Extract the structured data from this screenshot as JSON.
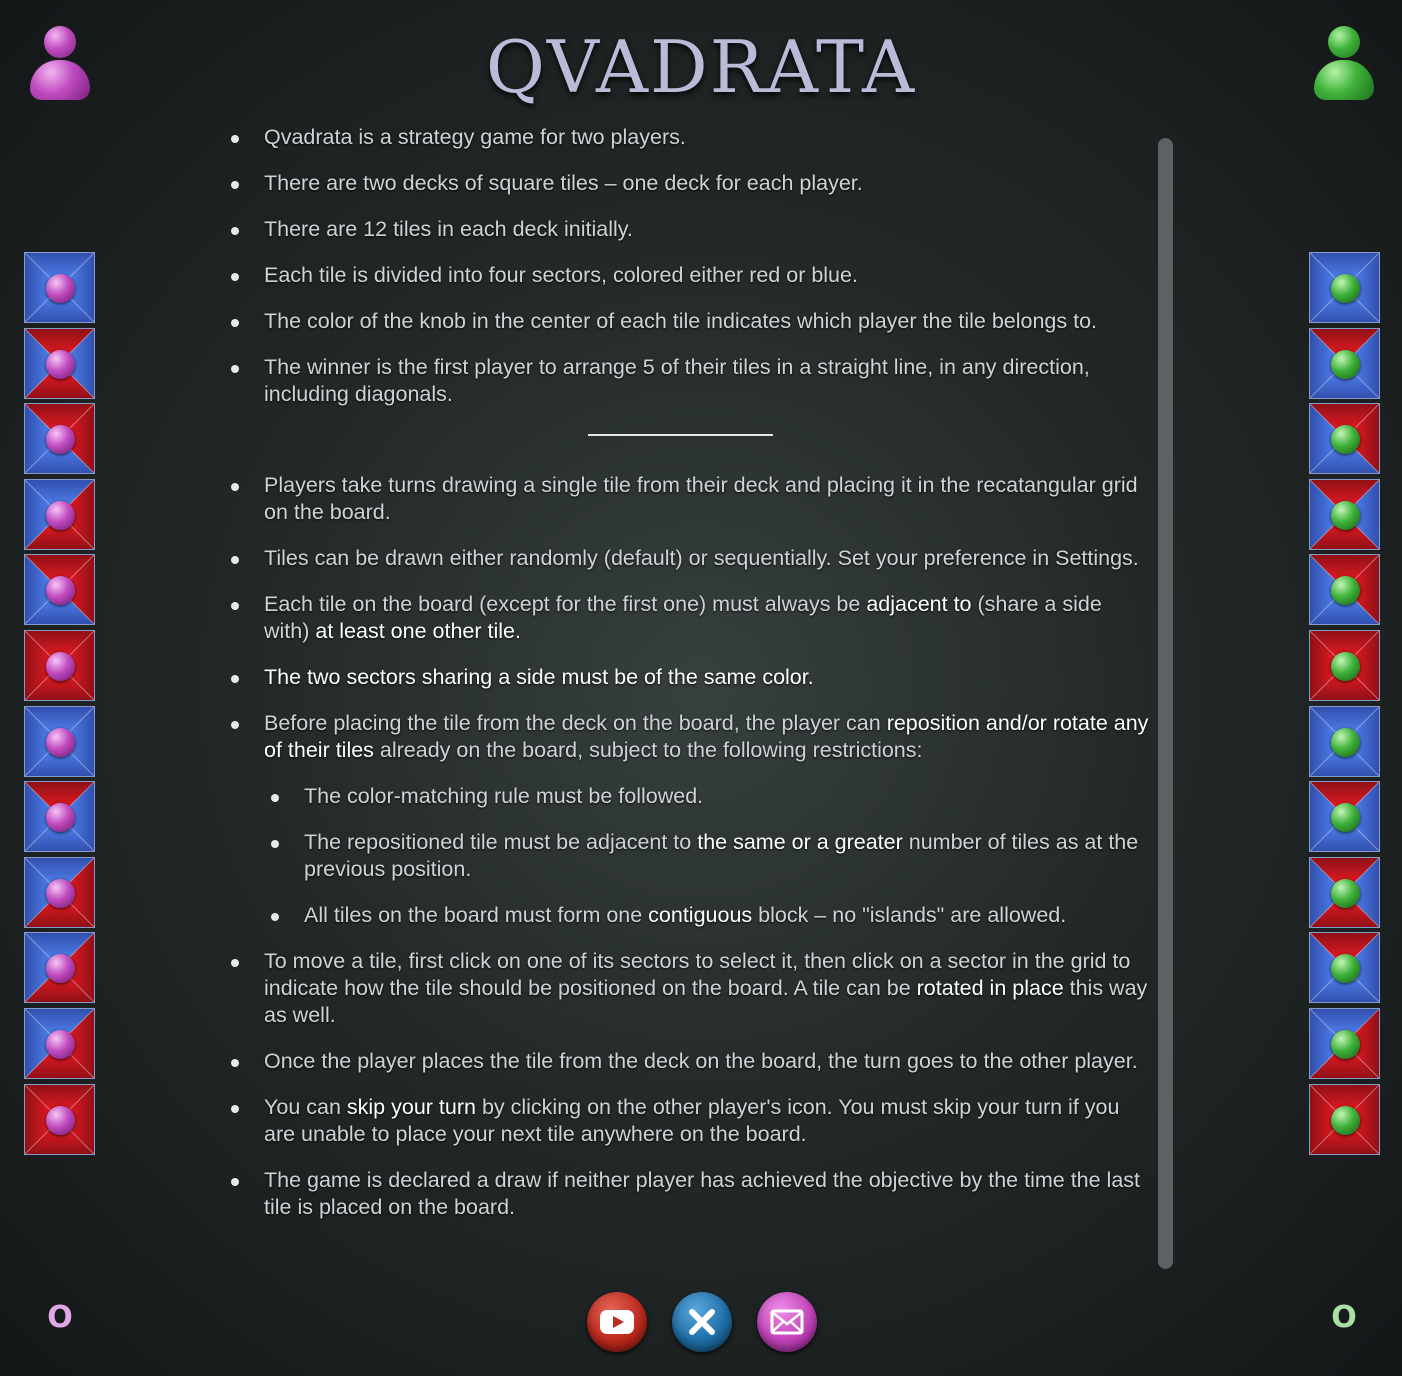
{
  "title": "QVADRATA",
  "players": {
    "left": {
      "icon": "purple-player-icon",
      "score": "O",
      "color": "#c04cc0"
    },
    "right": {
      "icon": "green-player-icon",
      "score": "O",
      "color": "#3fb23a"
    }
  },
  "colors": {
    "red": "#b3141b",
    "blue": "#3d63d9"
  },
  "decks": {
    "left": [
      [
        "blue",
        "blue",
        "blue",
        "blue"
      ],
      [
        "red",
        "blue",
        "red",
        "blue"
      ],
      [
        "red",
        "red",
        "blue",
        "blue"
      ],
      [
        "blue",
        "red",
        "red",
        "blue"
      ],
      [
        "red",
        "red",
        "blue",
        "blue"
      ],
      [
        "red",
        "red",
        "red",
        "red"
      ],
      [
        "blue",
        "blue",
        "blue",
        "blue"
      ],
      [
        "red",
        "blue",
        "blue",
        "blue"
      ],
      [
        "blue",
        "red",
        "red",
        "blue"
      ],
      [
        "blue",
        "red",
        "red",
        "blue"
      ],
      [
        "blue",
        "red",
        "red",
        "blue"
      ],
      [
        "red",
        "red",
        "red",
        "red"
      ]
    ],
    "right": [
      [
        "blue",
        "blue",
        "blue",
        "blue"
      ],
      [
        "red",
        "blue",
        "blue",
        "blue"
      ],
      [
        "red",
        "red",
        "blue",
        "blue"
      ],
      [
        "red",
        "blue",
        "red",
        "blue"
      ],
      [
        "red",
        "red",
        "blue",
        "blue"
      ],
      [
        "red",
        "red",
        "red",
        "red"
      ],
      [
        "blue",
        "blue",
        "blue",
        "blue"
      ],
      [
        "red",
        "blue",
        "blue",
        "blue"
      ],
      [
        "red",
        "blue",
        "red",
        "blue"
      ],
      [
        "red",
        "blue",
        "blue",
        "blue"
      ],
      [
        "blue",
        "red",
        "red",
        "blue"
      ],
      [
        "red",
        "red",
        "red",
        "red"
      ]
    ]
  },
  "rules": {
    "intro": [
      "Qvadrata is a strategy game for two players.",
      "There are two decks of square tiles – one deck for each player.",
      "There are 12 tiles in each deck initially.",
      "Each tile is divided into four sectors, colored either red or blue.",
      "The color of the knob in the center of each tile indicates which player the tile belongs to.",
      "The winner is the first player to arrange 5 of their tiles in a straight line, in any direction, including diagonals."
    ],
    "play_1": "Players take turns drawing a single tile from their deck and placing it in the recatangular grid on the board.",
    "play_2": "Tiles can be drawn either randomly (default) or sequentially. Set your preference in Settings.",
    "play_3": {
      "a": "Each tile on the board (except for the first one) must always be ",
      "b": "adjacent to",
      "c": " (share a side with) ",
      "d": "at least one other tile."
    },
    "play_4": "The two sectors sharing a side must be of the same color.",
    "play_5": {
      "a": "Before placing the tile from the deck on the board, the player can ",
      "b": "reposition and/or rotate any of their tiles",
      "c": " already on the board, subject to the following restrictions:"
    },
    "sub_1": "The color-matching rule must be followed.",
    "sub_2": {
      "a": "The repositioned tile must be adjacent to ",
      "b": "the same or a greater",
      "c": " number of tiles as at the previous position."
    },
    "sub_3": {
      "a": "All tiles on the board must form one ",
      "b": "contiguous",
      "c": " block – no \"islands\" are allowed."
    },
    "play_6": {
      "a": "To move a tile, first click on one of its sectors to select it, then click on a sector in the grid to indicate how the tile should be positioned on the board. A tile can be ",
      "b": "rotated in place",
      "c": " this way as well."
    },
    "play_7": "Once the player places the tile from the deck on the board, the turn goes to the other player.",
    "play_8": {
      "a": "You can ",
      "b": "skip your turn",
      "c": " by clicking on the other player's icon. You must skip your turn if you are unable to place your next tile anywhere on the board."
    },
    "play_9": "The game is declared a draw if neither player has achieved the objective by the time the last tile is placed on the board."
  },
  "buttons": {
    "youtube": {
      "icon": "youtube-icon",
      "color": "#bb2a1d"
    },
    "close": {
      "icon": "close-icon",
      "color": "#1f6ea6"
    },
    "mail": {
      "icon": "mail-icon",
      "color": "#c042b8"
    }
  }
}
